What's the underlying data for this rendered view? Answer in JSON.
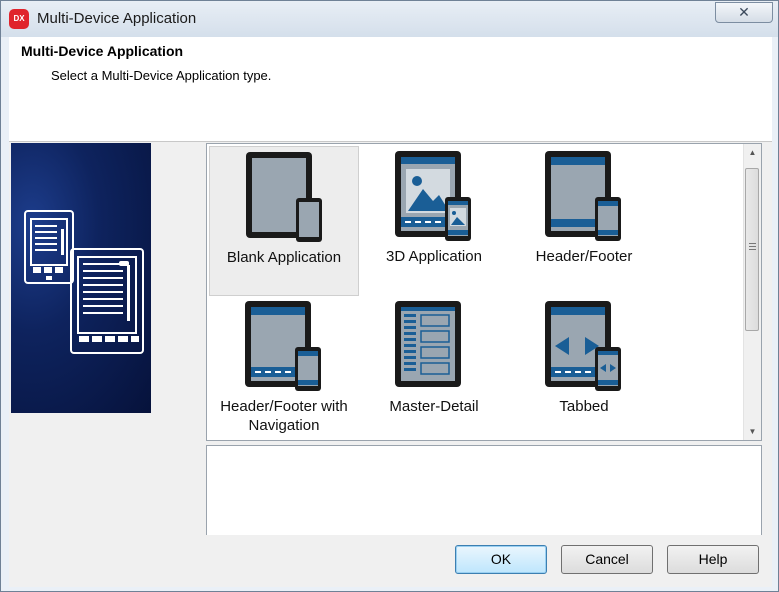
{
  "window": {
    "title": "Multi-Device Application",
    "icon_text": "DX",
    "close_glyph": "✕"
  },
  "header": {
    "title": "Multi-Device Application",
    "subtitle": "Select a Multi-Device Application type."
  },
  "gallery": {
    "items": [
      {
        "label": "Blank Application",
        "selected": true
      },
      {
        "label": "3D Application",
        "selected": false
      },
      {
        "label": "Header/Footer",
        "selected": false
      },
      {
        "label": "Header/Footer with Navigation",
        "selected": false
      },
      {
        "label": "Master-Detail",
        "selected": false
      },
      {
        "label": "Tabbed",
        "selected": false
      }
    ]
  },
  "buttons": {
    "ok": "OK",
    "cancel": "Cancel",
    "help": "Help"
  },
  "colors": {
    "accent_blue": "#1a5e96",
    "screen_gray": "#9aa6b1",
    "device_black": "#1a1a1a",
    "brand_red": "#e0242c"
  }
}
